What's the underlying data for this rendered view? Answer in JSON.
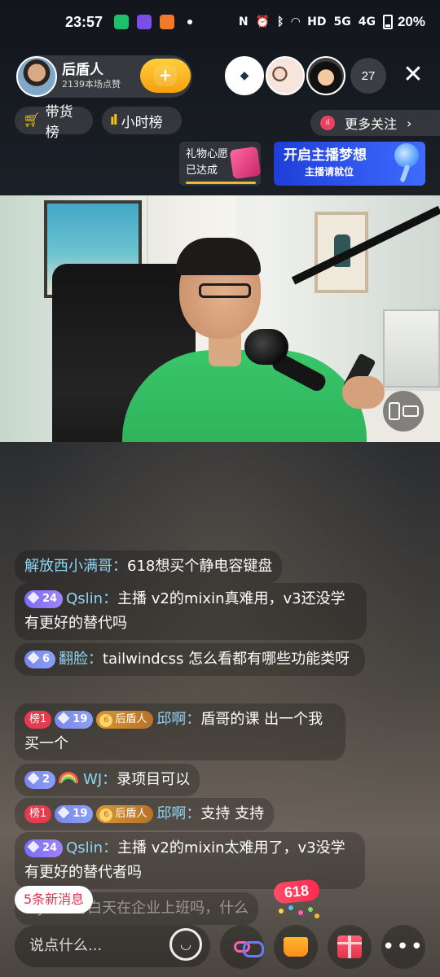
{
  "status_bar": {
    "time": "23:57",
    "battery": "20%",
    "icons": [
      "nfc-icon",
      "alarm-icon",
      "bluetooth-icon",
      "wifi-icon",
      "hd-icon",
      "signal-5g-icon",
      "signal-4g-icon",
      "battery-icon"
    ],
    "net_5g": "5G",
    "net_4g": "4G",
    "hd": "HD"
  },
  "host": {
    "name": "后盾人",
    "likes": "2139本场点赞"
  },
  "viewers": {
    "count": "27"
  },
  "chips": {
    "goods_rank": "带货榜",
    "hourly_rank": "小时榜",
    "more_follow": "更多关注"
  },
  "wish": {
    "title": "礼物心愿",
    "status": "已达成"
  },
  "dream_banner": {
    "title": "开启主播梦想",
    "subtitle": "主播请就位"
  },
  "chat": [
    {
      "user": "解放西小满哥",
      "text": "618想买个静电容键盘"
    },
    {
      "fan_level": "24",
      "user": "Qslin",
      "text": "主播 v2的mixin真难用，v3还没学 有更好的替代吗"
    },
    {
      "fan_level": "6",
      "user": "翻脸",
      "text": "tailwindcss 怎么看都有哪些功能类呀"
    },
    {
      "rank": "榜1",
      "level": "19",
      "club_level": "6",
      "club": "后盾人",
      "user": "邱啊",
      "text": "盾哥的课 出一个我买一个"
    },
    {
      "fan_level": "2",
      "user": "WJ",
      "text": "录项目可以"
    },
    {
      "rank": "榜1",
      "level": "19",
      "club_level": "6",
      "club": "后盾人",
      "user": "邱啊",
      "text": "支持 支持"
    },
    {
      "fan_level": "24",
      "user": "Qslin",
      "text": "主播 v2的mixin太难用了，v3没学 有更好的替代者吗"
    },
    {
      "user": "WJ",
      "text": "大哥白天在企业上班吗，什么"
    }
  ],
  "new_messages": "5条新消息",
  "input": {
    "placeholder": "说点什么..."
  },
  "promo_badge": "618",
  "colors": {
    "accent_gold": "#f6a00f",
    "username_blue": "#8fd4f5",
    "promo_red": "#ff2a4d"
  }
}
